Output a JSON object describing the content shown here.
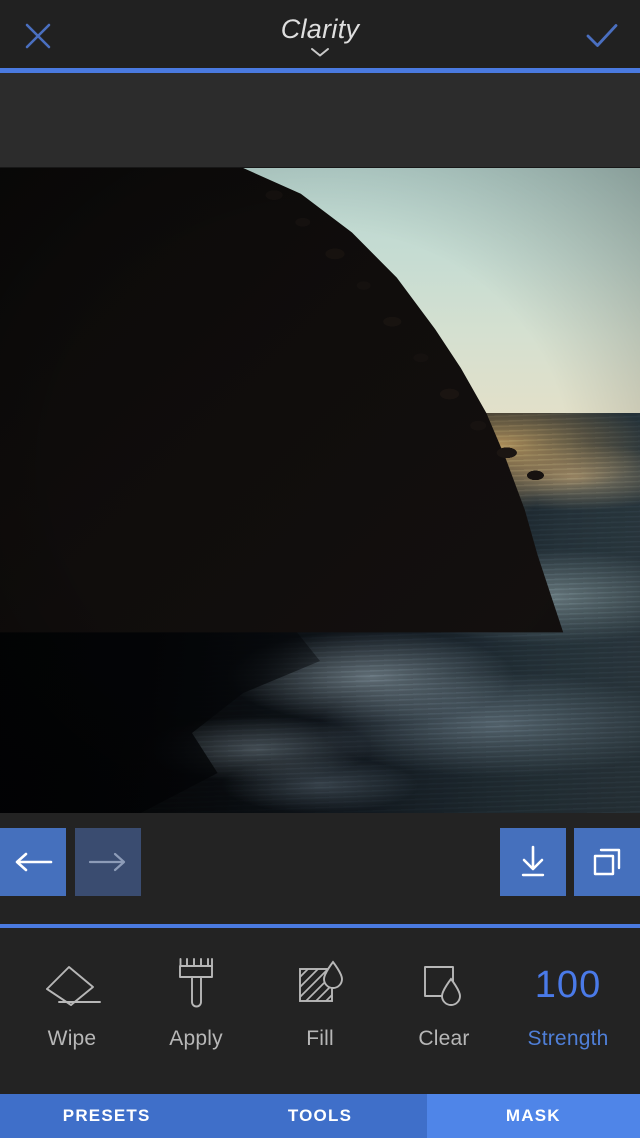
{
  "header": {
    "title": "Clarity",
    "close_icon": "close-x-icon",
    "confirm_icon": "checkmark-icon",
    "chevron_icon": "chevron-down-icon",
    "accent_color": "#4a7ae0",
    "icon_color": "#4a6fc0",
    "title_color": "#dedede"
  },
  "photo": {
    "alt": "sunset over lake with dark silhouetted tree-covered hillside and golden water reflections"
  },
  "actionbar": {
    "undo": {
      "name": "undo-button",
      "icon": "arrow-left-icon",
      "enabled": true
    },
    "redo": {
      "name": "redo-button",
      "icon": "arrow-right-icon",
      "enabled": false
    },
    "save": {
      "name": "save-button",
      "icon": "download-icon"
    },
    "copy": {
      "name": "duplicate-button",
      "icon": "copy-icon"
    },
    "active_color": "#4570bd",
    "disabled_color": "#3a4c70"
  },
  "mask_tools": [
    {
      "label": "Wipe",
      "icon": "eraser-icon"
    },
    {
      "label": "Apply",
      "icon": "paintbrush-icon"
    },
    {
      "label": "Fill",
      "icon": "fill-droplet-icon"
    },
    {
      "label": "Clear",
      "icon": "clear-droplet-icon"
    }
  ],
  "strength": {
    "value": "100",
    "label": "Strength",
    "value_color": "#4a7ae8",
    "label_color": "#4f7fd8"
  },
  "tabs": [
    {
      "label": "PRESETS",
      "active": false
    },
    {
      "label": "TOOLS",
      "active": false
    },
    {
      "label": "MASK",
      "active": true
    }
  ],
  "colors": {
    "header_bg": "#212121",
    "panel_bg": "#2c2c2c",
    "toolbar_bg": "#232323",
    "tab_bg": "#3f6fc9",
    "tab_active_bg": "#4f85e8"
  }
}
